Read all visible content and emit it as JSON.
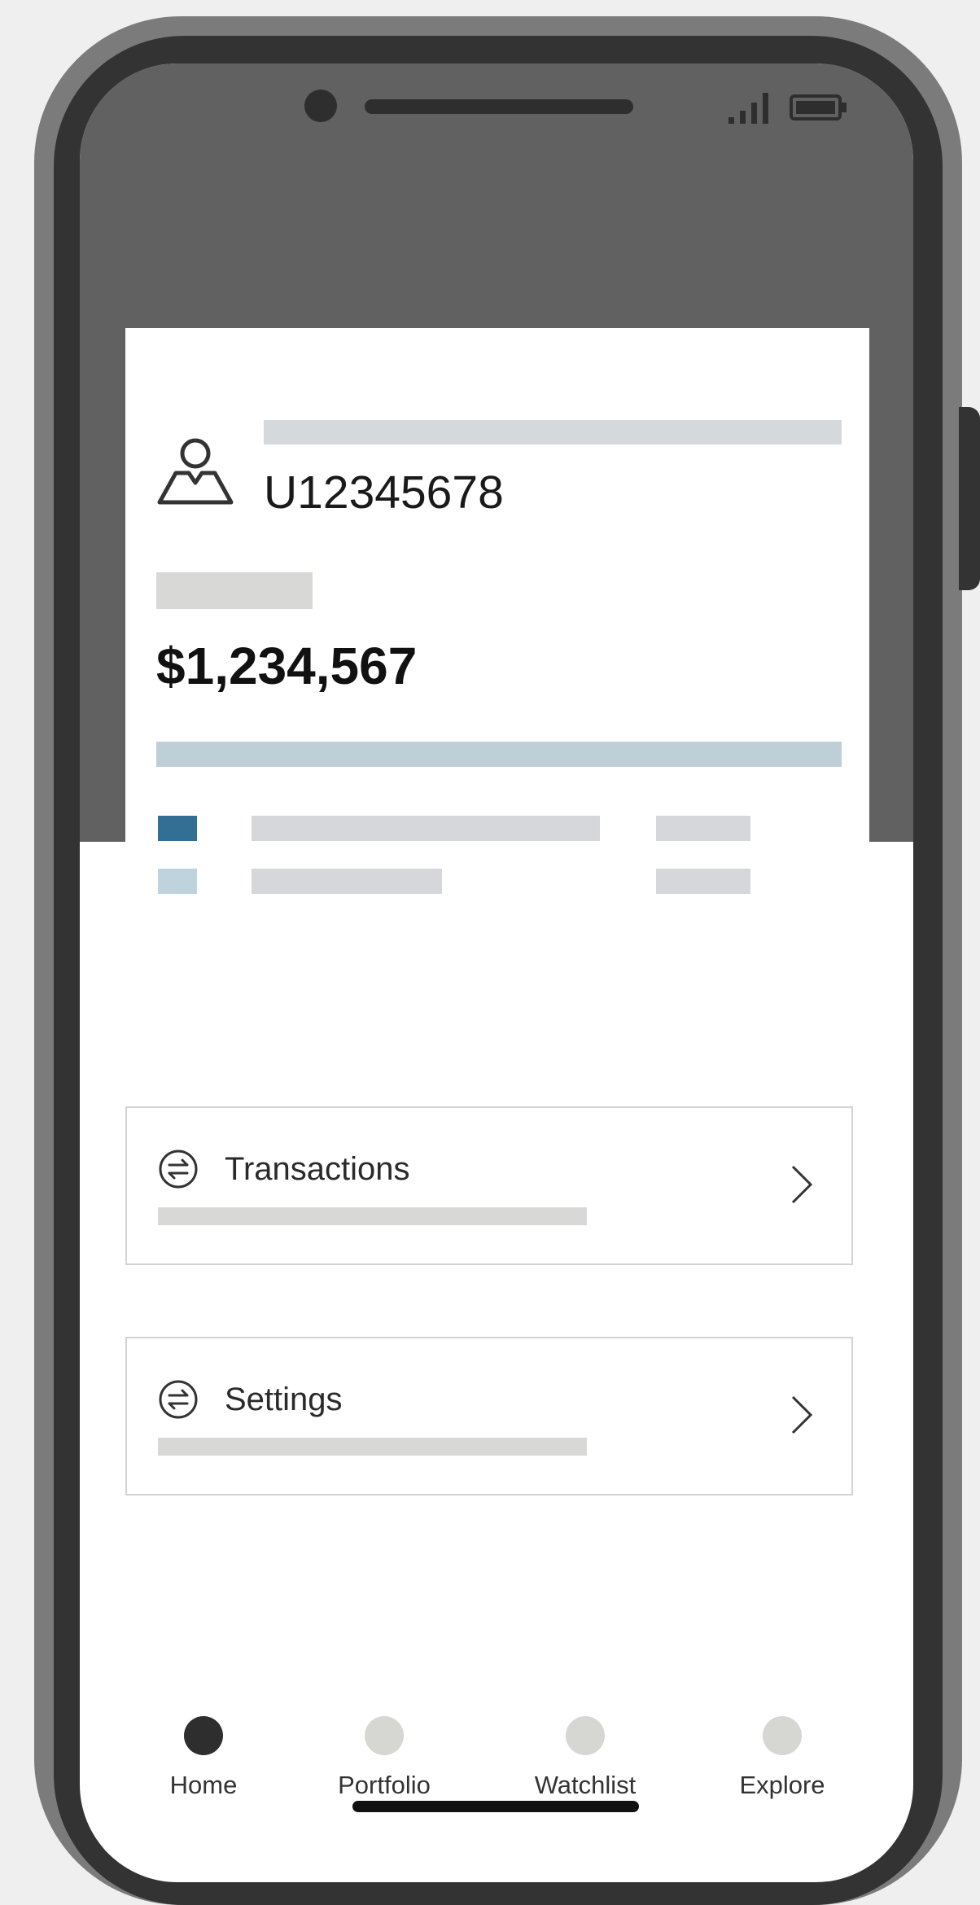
{
  "account": {
    "id": "U12345678",
    "balance": "$1,234,567",
    "allocation": {
      "colors": [
        "#336f95",
        "#bfd3de"
      ]
    }
  },
  "menu": [
    {
      "label": "Transactions",
      "icon": "swap-arrows-icon"
    },
    {
      "label": "Settings",
      "icon": "swap-arrows-icon"
    }
  ],
  "nav": {
    "active": "Home",
    "items": [
      {
        "label": "Home",
        "color": "#2e2e2e"
      },
      {
        "label": "Portfolio",
        "color": "#d6d6d2"
      },
      {
        "label": "Watchlist",
        "color": "#d6d6d2"
      },
      {
        "label": "Explore",
        "color": "#d6d6d2"
      }
    ]
  },
  "status_bar": {
    "icons": [
      "signal-icon",
      "battery-icon"
    ]
  }
}
